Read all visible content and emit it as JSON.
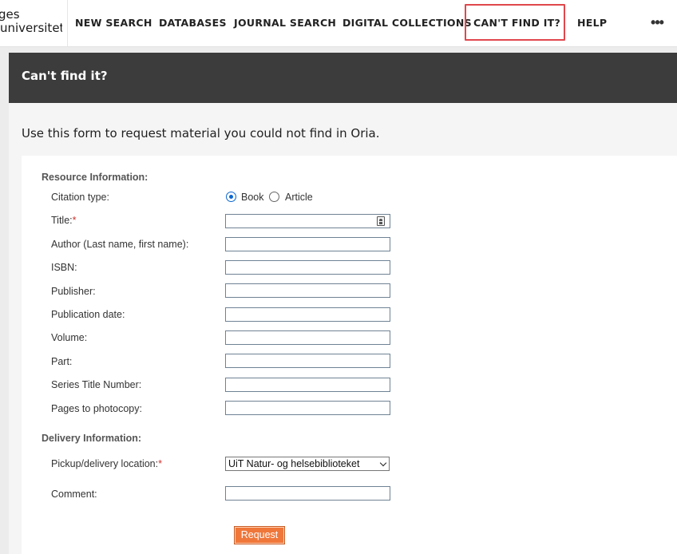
{
  "branding": {
    "logo_line1": "ges",
    "logo_line2": "universitet"
  },
  "nav": {
    "items": [
      {
        "label": "NEW SEARCH"
      },
      {
        "label": "DATABASES"
      },
      {
        "label": "JOURNAL SEARCH"
      },
      {
        "label": "DIGITAL COLLECTIONS"
      },
      {
        "label": "CAN'T FIND IT?"
      },
      {
        "label": "HELP"
      }
    ],
    "more_icon": "ellipsis-icon",
    "active": "CAN'T FIND IT?",
    "highlight_color": "#e0474c"
  },
  "page": {
    "title": "Can't find it?",
    "intro": "Use this form to request material you could not find in Oria."
  },
  "form": {
    "resource_section": "Resource Information:",
    "citation_type_label": "Citation type:",
    "citation_options": [
      {
        "label": "Book",
        "checked": true
      },
      {
        "label": "Article",
        "checked": false
      }
    ],
    "fields": [
      {
        "label": "Title:",
        "required": true,
        "value": "",
        "icon": "contact-card-icon"
      },
      {
        "label": "Author (Last name, first name):",
        "required": false,
        "value": ""
      },
      {
        "label": "ISBN:",
        "required": false,
        "value": ""
      },
      {
        "label": "Publisher:",
        "required": false,
        "value": ""
      },
      {
        "label": "Publication date:",
        "required": false,
        "value": ""
      },
      {
        "label": "Volume:",
        "required": false,
        "value": ""
      },
      {
        "label": "Part:",
        "required": false,
        "value": ""
      },
      {
        "label": "Series Title Number:",
        "required": false,
        "value": ""
      },
      {
        "label": "Pages to photocopy:",
        "required": false,
        "value": ""
      }
    ],
    "delivery_section": "Delivery Information:",
    "pickup_label": "Pickup/delivery location:",
    "pickup_required": true,
    "pickup_value": "UiT Natur- og helsebiblioteket",
    "comment_label": "Comment:",
    "comment_value": "",
    "submit_label": "Request"
  },
  "colors": {
    "header_band": "#3c3c3c",
    "button": "#f0773a",
    "radio_accent": "#0b66d0",
    "required_star": "#d0312d"
  }
}
